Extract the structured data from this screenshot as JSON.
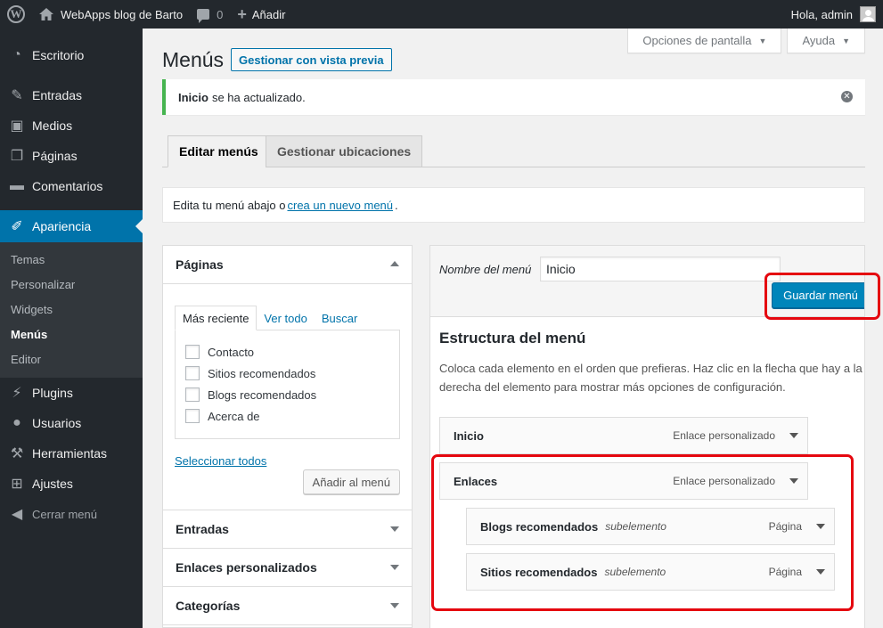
{
  "adminbar": {
    "site_name": "WebApps blog de Barto",
    "comments_count": "0",
    "new_label": "Añadir",
    "greeting": "Hola, admin"
  },
  "sidebar": {
    "items": [
      {
        "label": "Escritorio",
        "icon": "dashboard-icon"
      },
      {
        "label": "Entradas",
        "icon": "pin-icon"
      },
      {
        "label": "Medios",
        "icon": "media-icon"
      },
      {
        "label": "Páginas",
        "icon": "pages-icon"
      },
      {
        "label": "Comentarios",
        "icon": "comment-icon"
      },
      {
        "label": "Apariencia",
        "icon": "brush-icon"
      },
      {
        "label": "Plugins",
        "icon": "plugin-icon"
      },
      {
        "label": "Usuarios",
        "icon": "users-icon"
      },
      {
        "label": "Herramientas",
        "icon": "tools-icon"
      },
      {
        "label": "Ajustes",
        "icon": "settings-icon"
      },
      {
        "label": "Cerrar menú",
        "icon": "collapse-icon"
      }
    ],
    "submenu": [
      "Temas",
      "Personalizar",
      "Widgets",
      "Menús",
      "Editor"
    ]
  },
  "screen_meta": {
    "screen_options": "Opciones de pantalla",
    "help": "Ayuda"
  },
  "page": {
    "title": "Menús",
    "action": "Gestionar con vista previa"
  },
  "notice": {
    "bold": "Inicio",
    "text": "se ha actualizado."
  },
  "tabs": [
    "Editar menús",
    "Gestionar ubicaciones"
  ],
  "manage": {
    "prefix": "Edita tu menú abajo o",
    "link": "crea un nuevo menú",
    "suffix": "."
  },
  "left": {
    "pages_title": "Páginas",
    "mini_tabs": [
      "Más reciente",
      "Ver todo",
      "Buscar"
    ],
    "pages": [
      "Contacto",
      "Sitios recomendados",
      "Blogs recomendados",
      "Acerca de"
    ],
    "select_all": "Seleccionar todos",
    "add_button": "Añadir al menú",
    "sections": [
      "Entradas",
      "Enlaces personalizados",
      "Categorías"
    ]
  },
  "right": {
    "menu_name_label": "Nombre del menú",
    "menu_name_value": "Inicio",
    "save_button": "Guardar menú",
    "structure_title": "Estructura del menú",
    "structure_desc": "Coloca cada elemento en el orden que prefieras. Haz clic en la flecha que hay a la derecha del elemento para mostrar más opciones de configuración.",
    "items": [
      {
        "title": "Inicio",
        "sub": "",
        "type": "Enlace personalizado"
      },
      {
        "title": "Enlaces",
        "sub": "",
        "type": "Enlace personalizado"
      },
      {
        "title": "Blogs recomendados",
        "sub": "subelemento",
        "type": "Página"
      },
      {
        "title": "Sitios recomendados",
        "sub": "subelemento",
        "type": "Página"
      }
    ]
  },
  "colors": {
    "highlight": "#e5070f",
    "primary": "#0085ba",
    "accent": "#0073aa"
  }
}
